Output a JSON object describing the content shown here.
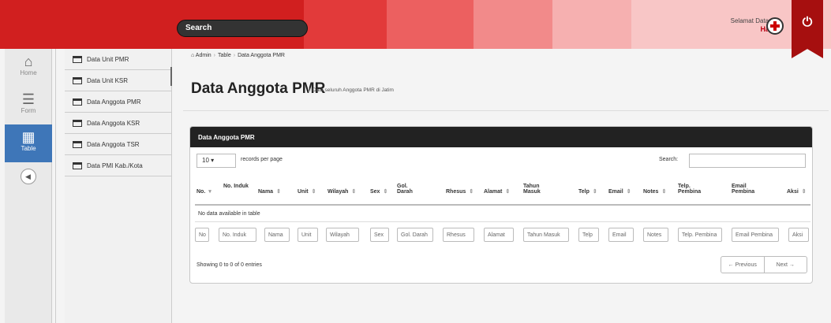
{
  "header": {
    "search_label": "Search",
    "welcome": "Selamat Datang",
    "user": "Hadi"
  },
  "nav": [
    {
      "label": "Home",
      "icon": "home-icon"
    },
    {
      "label": "Form",
      "icon": "list-icon"
    },
    {
      "label": "Table",
      "icon": "table-icon"
    }
  ],
  "submenu": [
    "Data Unit PMR",
    "Data Unit KSR",
    "Data Anggota PMR",
    "Data Anggota KSR",
    "Data Anggota TSR",
    "Data PMI Kab./Kota"
  ],
  "breadcrumb": {
    "admin": "Admin",
    "table": "Table",
    "current": "Data Anggota PMR"
  },
  "page": {
    "title": "Data Anggota PMR",
    "subtitle": "Data seluruh Anggota PMR di Jatim"
  },
  "table": {
    "box_title": "Data Anggota PMR",
    "length_value": "10",
    "length_text": "records per page",
    "search_label": "Search:",
    "columns": [
      "No.",
      "No. Induk",
      "Nama",
      "Unit",
      "Wilayah",
      "Sex",
      "Gol. Darah",
      "Rhesus",
      "Alamat",
      "Tahun Masuk",
      "Telp",
      "Email",
      "Notes",
      "Telp. Pembina",
      "Email Pembina",
      "Aksi"
    ],
    "filters": [
      "No",
      "No. Induk",
      "Nama",
      "Unit",
      "Wilayah",
      "Sex",
      "Gol. Darah",
      "Rhesus",
      "Alamat",
      "Tahun Masuk",
      "Telp",
      "Email",
      "Notes",
      "Telp. Pembina",
      "Email Pembina",
      "Aksi"
    ],
    "empty_text": "No data available in table",
    "showing": "Showing 0 to 0 of 0 entries",
    "prev": "← Previous",
    "next": "Next →"
  }
}
